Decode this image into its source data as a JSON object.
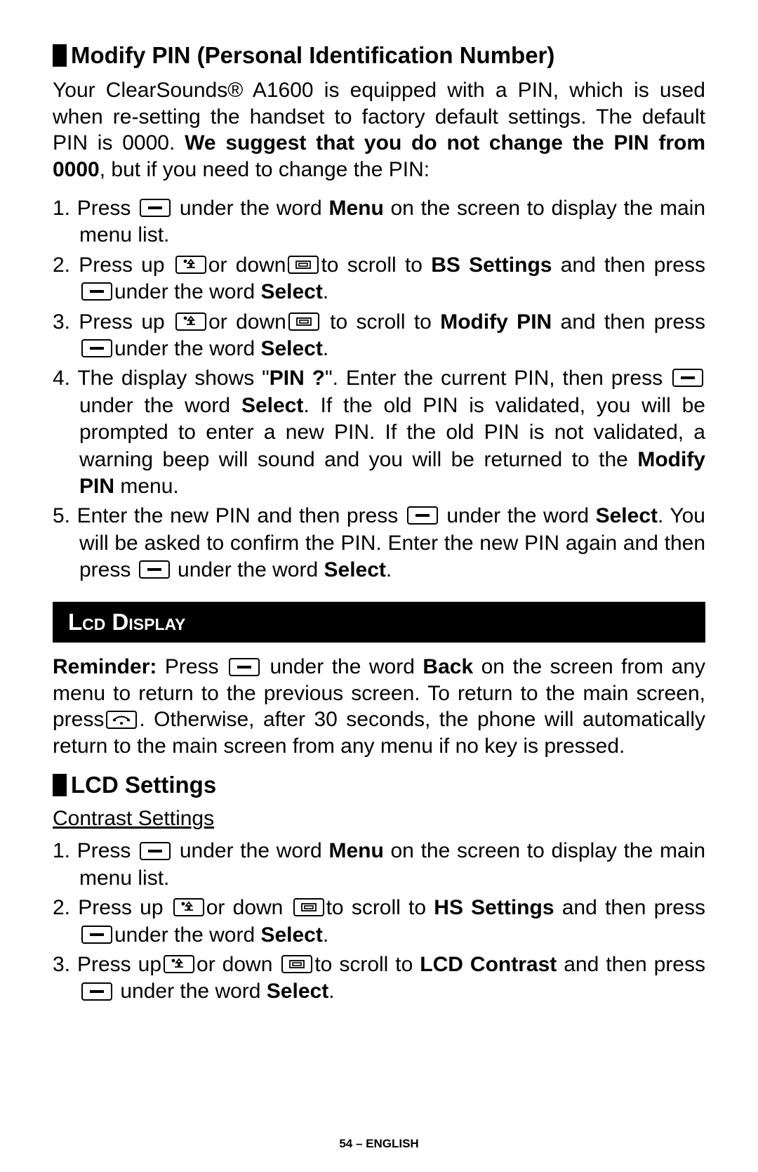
{
  "section1": {
    "title": "Modify PIN (Personal Identification Number)",
    "intro": {
      "t1": "Your ClearSounds® A1600 is equipped with a PIN, which is used when re-setting the handset to factory default settings. The default PIN is 0000. ",
      "t2": "We suggest that you do not change the PIN from 0000",
      "t3": ", but if you need to change the PIN:"
    },
    "steps": {
      "s1a": "1. Press ",
      "s1b": " under the word ",
      "s1c": "Menu",
      "s1d": " on the screen to display the main menu list.",
      "s2a": "2. Press up ",
      "s2b": "or down",
      "s2c": "to scroll to ",
      "s2d": "BS Settings",
      "s2e": " and then press",
      "s2f": "under the word ",
      "s2g": "Select",
      "s2h": ".",
      "s3a": "3. Press up ",
      "s3b": "or down",
      "s3c": " to scroll to ",
      "s3d": "Modify PIN",
      "s3e": " and then press",
      "s3f": "under the word ",
      "s3g": "Select",
      "s3h": ".",
      "s4a": "4. The display shows \"",
      "s4b": "PIN ?",
      "s4c": "\". Enter the current PIN, then press",
      "s4d": "under the word ",
      "s4e": "Select",
      "s4f": ".  If the old PIN is validated, you will be prompted to enter a new PIN.  If the old PIN is not validated, a warning beep will sound and you will be returned to the ",
      "s4g": "Modify PIN",
      "s4h": " menu.",
      "s5a": "5. Enter the new PIN and then press ",
      "s5b": " under the word ",
      "s5c": "Select",
      "s5d": ". You will be asked to confirm the PIN.  Enter the new PIN again and then press",
      "s5e": " under the word ",
      "s5f": "Select",
      "s5g": "."
    }
  },
  "banner": "Lcd Display",
  "reminder": {
    "r1": "Reminder:",
    "r2": " Press ",
    "r3": " under the word ",
    "r4": "Back",
    "r5": " on the screen from any menu to return to the previous screen.  To return to the main screen, press",
    "r6": ". Otherwise, after 30 seconds, the phone will automatically return to the main screen from any menu if no key is pressed."
  },
  "section2": {
    "title": "LCD Settings",
    "sub": "Contrast Settings",
    "steps": {
      "s1a": "1. Press ",
      "s1b": " under the word ",
      "s1c": "Menu",
      "s1d": " on the screen to display the main menu list.",
      "s2a": "2. Press up ",
      "s2b": "or down ",
      "s2c": "to scroll to ",
      "s2d": "HS Settings",
      "s2e": " and then press ",
      "s2f": "under the word ",
      "s2g": "Select",
      "s2h": ".",
      "s3a": "3. Press up",
      "s3b": "or down ",
      "s3c": "to scroll to ",
      "s3d": "LCD Contrast",
      "s3e": " and then press",
      "s3f": " under the word ",
      "s3g": "Select",
      "s3h": "."
    }
  },
  "footer": "54 – ENGLISH"
}
